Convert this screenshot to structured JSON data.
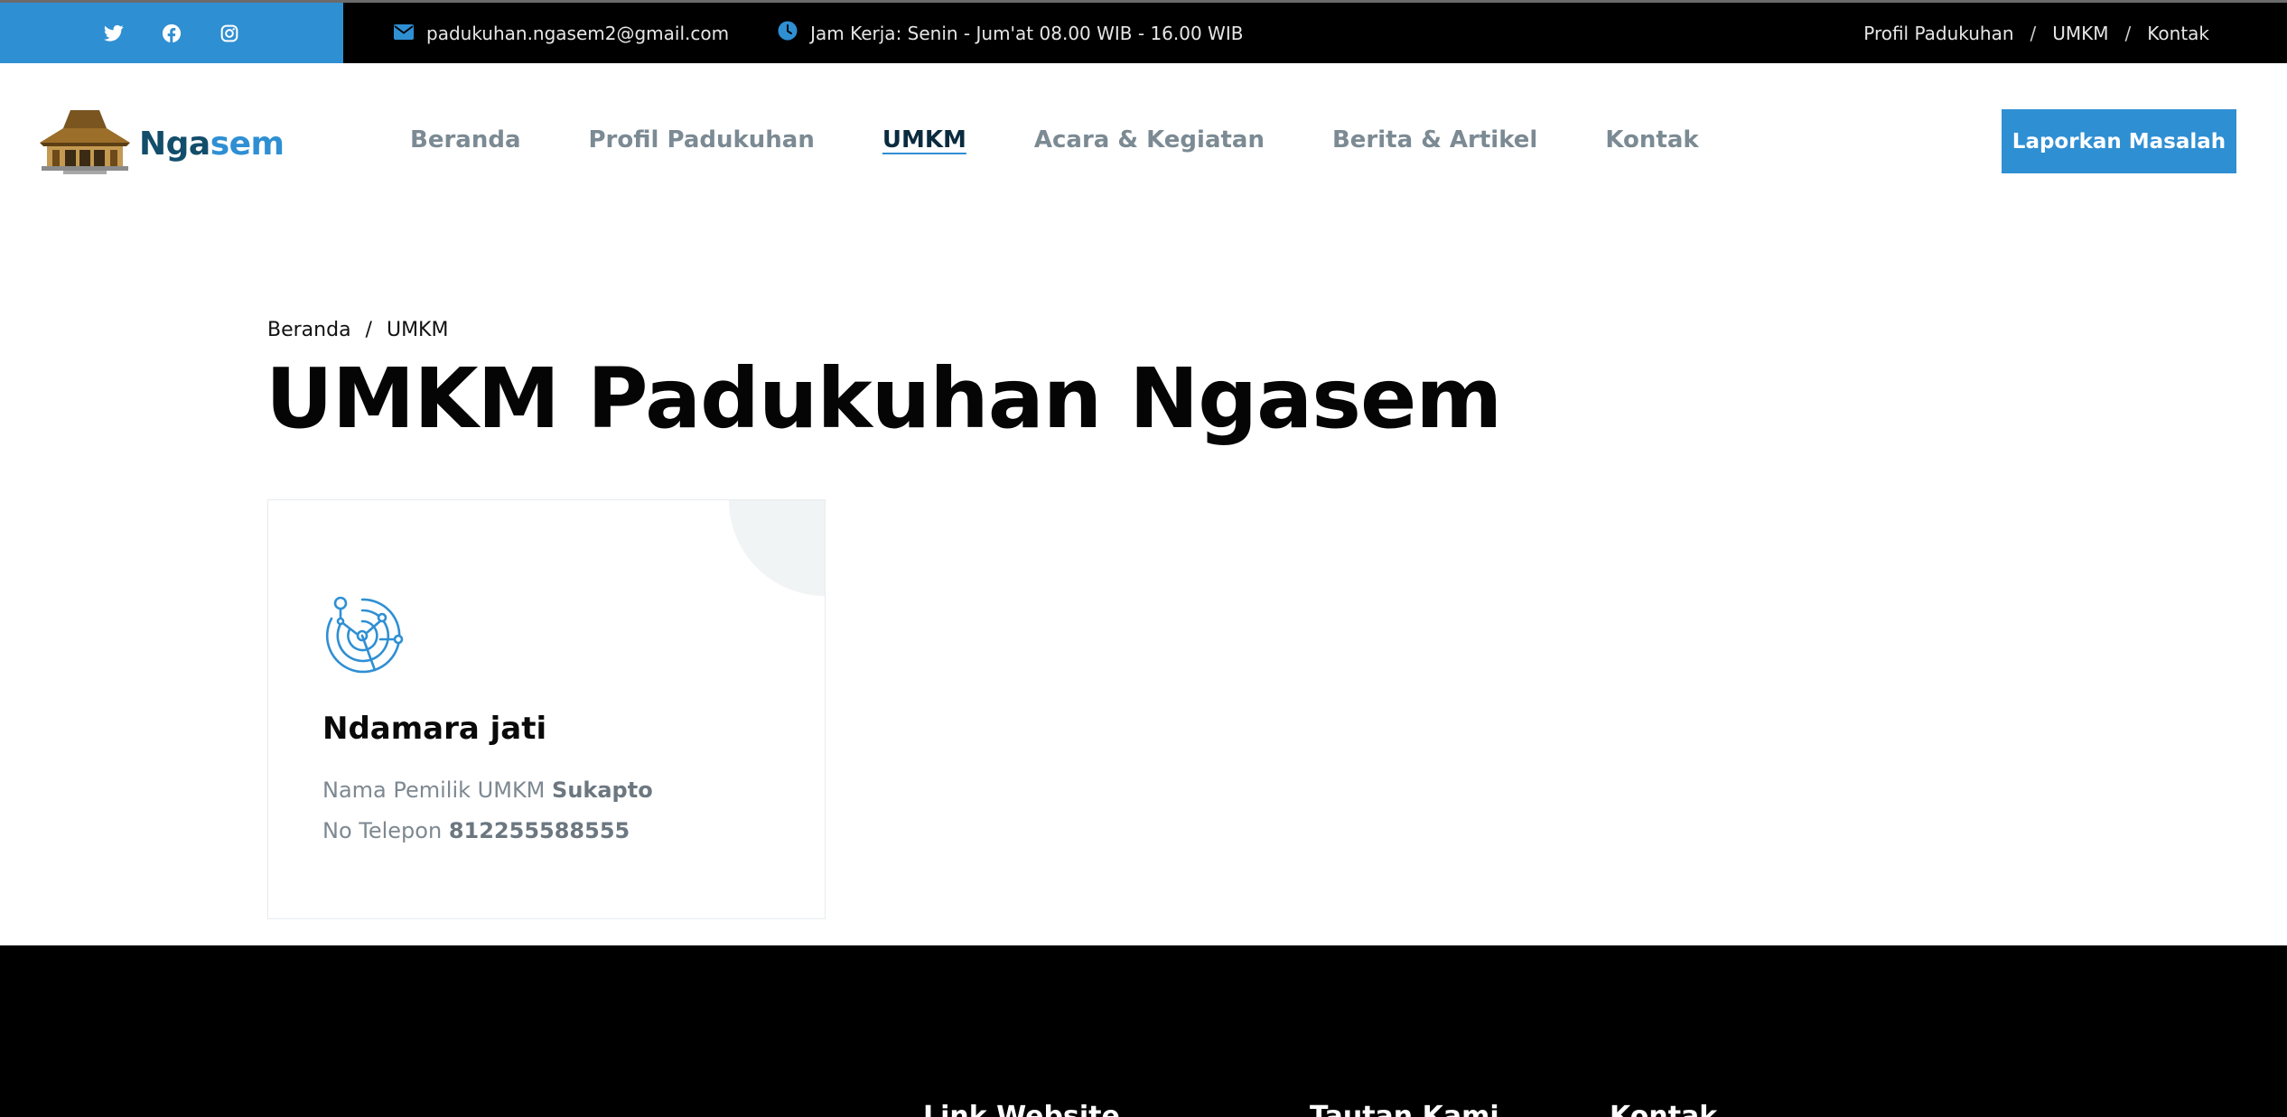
{
  "topbar": {
    "social": [
      {
        "name": "twitter-icon"
      },
      {
        "name": "facebook-icon"
      },
      {
        "name": "instagram-icon"
      }
    ],
    "email": "padukuhan.ngasem2@gmail.com",
    "hours": "Jam Kerja: Senin - Jum'at 08.00 WIB - 16.00 WIB",
    "links": [
      "Profil Padukuhan",
      "UMKM",
      "Kontak"
    ],
    "separator": "/"
  },
  "brand": {
    "name_part1": "Nga",
    "name_part2": "sem",
    "primary_color": "#124d6b",
    "accent_color": "#2f8fd3"
  },
  "nav": {
    "items": [
      "Beranda",
      "Profil Padukuhan",
      "UMKM",
      "Acara & Kegiatan",
      "Berita & Artikel",
      "Kontak"
    ],
    "active": "UMKM"
  },
  "cta": {
    "label": "Laporkan Masalah"
  },
  "breadcrumb": {
    "home": "Beranda",
    "separator": "/",
    "current": "UMKM"
  },
  "page": {
    "title": "UMKM Padukuhan Ngasem"
  },
  "umkm": {
    "cards": [
      {
        "icon": "radar-signal-icon",
        "title": "Ndamara jati",
        "owner_label": "Nama Pemilik UMKM",
        "owner": "Sukapto",
        "phone_label": "No Telepon",
        "phone": "812255588555"
      }
    ]
  },
  "footer": {
    "headings": [
      "Link Website",
      "Tautan Kami",
      "Kontak"
    ]
  }
}
